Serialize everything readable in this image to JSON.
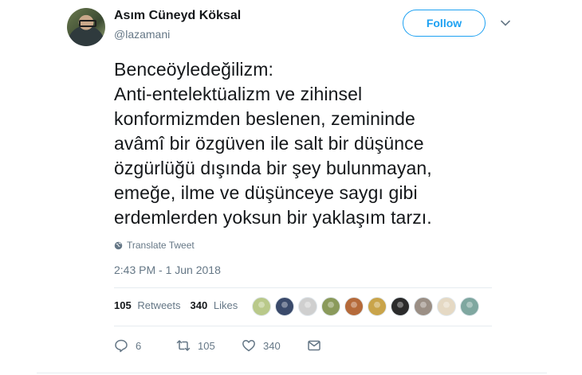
{
  "user": {
    "name": "Asım Cüneyd Köksal",
    "handle": "@lazamani",
    "follow_label": "Follow"
  },
  "tweet": {
    "text": "Benceöyledeğilizm:\nAnti-entelektüalizm ve zihinsel\nkonformizmden beslenen, zemininde\navâmî bir özgüven ile salt bir düşünce\nözgürlüğü dışında bir şey bulunmayan,\nemeğe, ilme  ve düşünceye saygı gibi\nerdemlerden yoksun bir yaklaşım tarzı.",
    "translate_label": "Translate Tweet",
    "timestamp": "2:43 PM - 1 Jun 2018"
  },
  "stats": {
    "retweets_count": "105",
    "retweets_label": "Retweets",
    "likes_count": "340",
    "likes_label": "Likes"
  },
  "liker_colors": [
    "#b9c98a",
    "#3a4a6b",
    "#cfcfcf",
    "#8a9a5b",
    "#b56a3a",
    "#c9a44a",
    "#2b2b2b",
    "#9b8f85",
    "#e5d9c4",
    "#7fa7a0"
  ],
  "actions": {
    "replies": "6",
    "retweets": "105",
    "likes": "340"
  },
  "colors": {
    "accent": "#1da1f2",
    "secondary_text": "#657786",
    "primary_text": "#14171a"
  }
}
